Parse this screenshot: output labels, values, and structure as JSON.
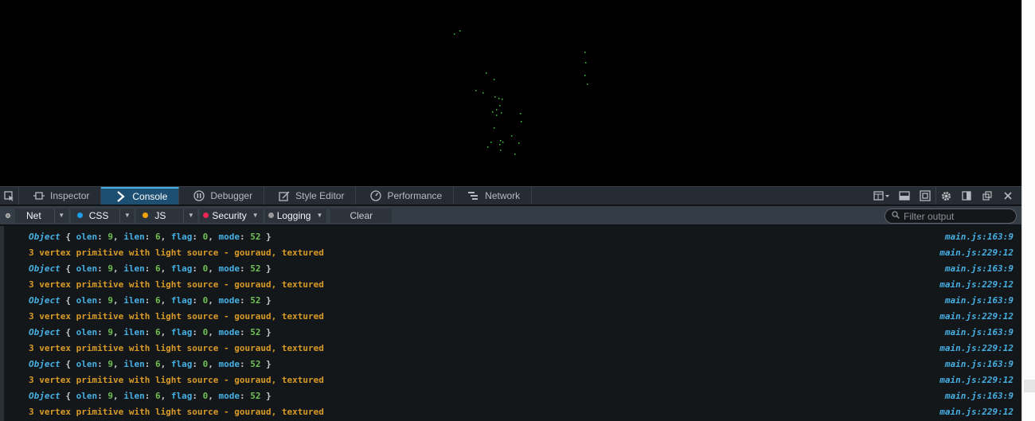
{
  "toolbar": {
    "tabs": [
      {
        "label": "Inspector",
        "icon": "inspector-icon"
      },
      {
        "label": "Console",
        "icon": "console-icon",
        "active": true
      },
      {
        "label": "Debugger",
        "icon": "debugger-icon"
      },
      {
        "label": "Style Editor",
        "icon": "style-editor-icon"
      },
      {
        "label": "Performance",
        "icon": "performance-icon"
      },
      {
        "label": "Network",
        "icon": "network-icon"
      }
    ]
  },
  "filters": {
    "net": {
      "label": "Net"
    },
    "css": {
      "label": "CSS",
      "color": "#1c9ee8"
    },
    "js": {
      "label": "JS",
      "color": "#f0a30a"
    },
    "security": {
      "label": "Security",
      "color": "#ed2655"
    },
    "logging": {
      "label": "Logging",
      "color": "#999999"
    },
    "clear": "Clear",
    "search_placeholder": "Filter output"
  },
  "console": {
    "rows": [
      {
        "type": "obj",
        "kw": "Object",
        "olen": "9",
        "ilen": "6",
        "flag": "0",
        "mode": "52",
        "src": "main.js:163:9"
      },
      {
        "type": "warn",
        "text": "3 vertex primitive with light source - gouraud, textured",
        "src": "main.js:229:12"
      },
      {
        "type": "obj",
        "kw": "Object",
        "olen": "9",
        "ilen": "6",
        "flag": "0",
        "mode": "52",
        "src": "main.js:163:9"
      },
      {
        "type": "warn",
        "text": "3 vertex primitive with light source - gouraud, textured",
        "src": "main.js:229:12"
      },
      {
        "type": "obj",
        "kw": "Object",
        "olen": "9",
        "ilen": "6",
        "flag": "0",
        "mode": "52",
        "src": "main.js:163:9"
      },
      {
        "type": "warn",
        "text": "3 vertex primitive with light source - gouraud, textured",
        "src": "main.js:229:12"
      },
      {
        "type": "obj",
        "kw": "Object",
        "olen": "9",
        "ilen": "6",
        "flag": "0",
        "mode": "52",
        "src": "main.js:163:9"
      },
      {
        "type": "warn",
        "text": "3 vertex primitive with light source - gouraud, textured",
        "src": "main.js:229:12"
      },
      {
        "type": "obj",
        "kw": "Object",
        "olen": "9",
        "ilen": "6",
        "flag": "0",
        "mode": "52",
        "src": "main.js:163:9"
      },
      {
        "type": "warn",
        "text": "3 vertex primitive with light source - gouraud, textured",
        "src": "main.js:229:12"
      },
      {
        "type": "obj",
        "kw": "Object",
        "olen": "9",
        "ilen": "6",
        "flag": "0",
        "mode": "52",
        "src": "main.js:163:9"
      },
      {
        "type": "warn",
        "text": "3 vertex primitive with light source - gouraud, textured",
        "src": "main.js:229:12"
      }
    ]
  },
  "colors": {
    "accent": "#46afe3",
    "warning_text": "#d99b28",
    "number": "#70bf53",
    "canvas_point": "#3ad13a"
  }
}
